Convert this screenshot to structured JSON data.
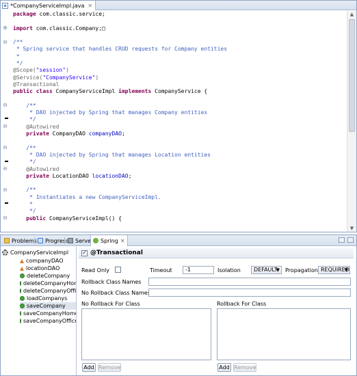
{
  "editor": {
    "tab_label": "*CompanyServiceImpl.java",
    "tab_close": "✕",
    "lines": [
      [
        {
          "t": "package ",
          "c": "kw"
        },
        {
          "t": "com.classic.service;",
          "c": ""
        }
      ],
      [],
      [
        {
          "t": "import ",
          "c": "kw"
        },
        {
          "t": "com.classic.Company;",
          "c": ""
        },
        {
          "t": "□",
          "c": ""
        }
      ],
      [],
      [
        {
          "t": "/**",
          "c": "cm"
        }
      ],
      [
        {
          "t": " * Spring service that handles CRUD requests for Company entities",
          "c": "cm"
        }
      ],
      [
        {
          "t": " *",
          "c": "cm"
        }
      ],
      [
        {
          "t": " */",
          "c": "cm"
        }
      ],
      [
        {
          "t": "@Scope(",
          "c": "an"
        },
        {
          "t": "\"session\"",
          "c": "st"
        },
        {
          "t": ")",
          "c": "an"
        }
      ],
      [
        {
          "t": "@Service(",
          "c": "an"
        },
        {
          "t": "\"CompanyService\"",
          "c": "st"
        },
        {
          "t": ")",
          "c": "an"
        }
      ],
      [
        {
          "t": "@Transactional",
          "c": "an"
        }
      ],
      [
        {
          "t": "public class ",
          "c": "kw"
        },
        {
          "t": "CompanyServiceImpl ",
          "c": ""
        },
        {
          "t": "implements ",
          "c": "kw"
        },
        {
          "t": "CompanyService {",
          "c": ""
        }
      ],
      [],
      [
        {
          "t": "    /**",
          "c": "cm"
        }
      ],
      [
        {
          "t": "     * DAO injected by Spring that manages Company entities",
          "c": "cm"
        }
      ],
      [
        {
          "t": "     */",
          "c": "cm"
        }
      ],
      [
        {
          "t": "    @Autowired",
          "c": "an"
        }
      ],
      [
        {
          "t": "    private ",
          "c": "kw"
        },
        {
          "t": "CompanyDAO ",
          "c": ""
        },
        {
          "t": "companyDAO",
          "c": "fd"
        },
        {
          "t": ";",
          "c": ""
        }
      ],
      [],
      [
        {
          "t": "    /**",
          "c": "cm"
        }
      ],
      [
        {
          "t": "     * DAO injected by Spring that manages Location entities",
          "c": "cm"
        }
      ],
      [
        {
          "t": "     */",
          "c": "cm"
        }
      ],
      [
        {
          "t": "    @Autowired",
          "c": "an"
        }
      ],
      [
        {
          "t": "    private ",
          "c": "kw"
        },
        {
          "t": "LocationDAO ",
          "c": ""
        },
        {
          "t": "locationDAO",
          "c": "fd"
        },
        {
          "t": ";",
          "c": ""
        }
      ],
      [],
      [
        {
          "t": "    /**",
          "c": "cm"
        }
      ],
      [
        {
          "t": "     * Instantiates a new CompanyServiceImpl.",
          "c": "cm"
        }
      ],
      [
        {
          "t": "     *",
          "c": "cm"
        }
      ],
      [
        {
          "t": "     */",
          "c": "cm"
        }
      ],
      [
        {
          "t": "    public ",
          "c": "kw"
        },
        {
          "t": "CompanyServiceImpl() {",
          "c": ""
        }
      ]
    ]
  },
  "views": {
    "tabs": [
      {
        "label": "Problems",
        "icon": "problems-icon",
        "active": false
      },
      {
        "label": "Progress",
        "icon": "progress-icon",
        "active": false
      },
      {
        "label": "Servers",
        "icon": "servers-icon",
        "active": false
      },
      {
        "label": "Spring",
        "icon": "spring-icon",
        "active": true
      }
    ],
    "active_tab_close": "✕"
  },
  "tree": {
    "root": "CompanyServiceImpl",
    "items": [
      {
        "label": "companyDAO",
        "kind": "field"
      },
      {
        "label": "locationDAO",
        "kind": "field"
      },
      {
        "label": "deleteCompany",
        "kind": "method"
      },
      {
        "label": "deleteCompanyHome",
        "kind": "method"
      },
      {
        "label": "deleteCompanyOffice",
        "kind": "method"
      },
      {
        "label": "loadCompanys",
        "kind": "method"
      },
      {
        "label": "saveCompany",
        "kind": "method",
        "selected": true
      },
      {
        "label": "saveCompanyHomeC",
        "kind": "method"
      },
      {
        "label": "saveCompanyOffices",
        "kind": "method"
      }
    ]
  },
  "props": {
    "title": "@Transactional",
    "read_only_label": "Read Only",
    "timeout_label": "Timeout",
    "timeout_value": "-1",
    "isolation_label": "Isolation",
    "isolation_value": "DEFAULT",
    "propagation_label": "Propagation",
    "propagation_value": "REQUIRED",
    "rollback_class_names_label": "Rollback Class Names",
    "no_rollback_class_names_label": "No Rollback Class Names",
    "no_rollback_for_class_label": "No Rollback For Class",
    "rollback_for_class_label": "Rollback For Class",
    "add_label": "Add",
    "remove_label": "Remove"
  },
  "colors": {
    "keyword": "#7f0055",
    "comment": "#3f5fbf",
    "annotation": "#646464",
    "string": "#2a00ff",
    "field": "#0000c0"
  }
}
